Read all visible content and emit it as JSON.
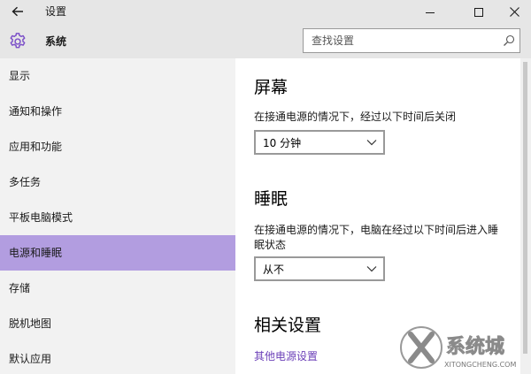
{
  "window": {
    "title": "设置"
  },
  "header": {
    "title": "系统",
    "search_placeholder": "查找设置"
  },
  "sidebar": {
    "items": [
      {
        "label": "显示"
      },
      {
        "label": "通知和操作"
      },
      {
        "label": "应用和功能"
      },
      {
        "label": "多任务"
      },
      {
        "label": "平板电脑模式"
      },
      {
        "label": "电源和睡眠",
        "selected": true
      },
      {
        "label": "存储"
      },
      {
        "label": "脱机地图"
      },
      {
        "label": "默认应用"
      }
    ]
  },
  "main": {
    "screen": {
      "heading": "屏幕",
      "description": "在接通电源的情况下，经过以下时间后关闭",
      "dropdown_value": "10 分钟"
    },
    "sleep": {
      "heading": "睡眠",
      "description": "在接通电源的情况下，电脑在经过以下时间后进入睡眠状态",
      "dropdown_value": "从不"
    },
    "related": {
      "heading": "相关设置",
      "link": "其他电源设置"
    }
  },
  "watermark": {
    "brand": "系统城",
    "url": "XITONGCHENG.COM"
  },
  "colors": {
    "accent": "#b29de0",
    "gear": "#7b4fc8",
    "link": "#6b3fb8",
    "chrome": "#e6e6e6",
    "sidebar": "#f2f2f2"
  },
  "icons": {
    "back": "back-arrow-icon",
    "minimize": "minimize-icon",
    "maximize": "maximize-icon",
    "close": "close-icon",
    "system": "gear-icon",
    "search": "search-icon",
    "dropdown": "chevron-down-icon"
  }
}
